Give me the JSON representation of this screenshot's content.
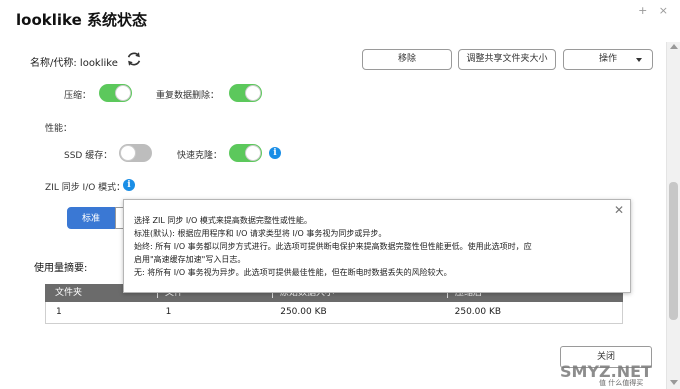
{
  "window": {
    "title": "looklike  系统状态",
    "controls": "+  ×"
  },
  "header": {
    "name_label": "名称/代称: looklike",
    "buttons": {
      "remove": "移除",
      "resize": "调整共享文件夹大小",
      "action": "操作"
    }
  },
  "options": {
    "compress": {
      "label": "压缩：",
      "state": "on"
    },
    "dedup": {
      "label": "重复数据删除：",
      "state": "on"
    },
    "performance_label": "性能：",
    "ssd_cache": {
      "label": "SSD 缓存：",
      "state": "off"
    },
    "fast_clone": {
      "label": "快速克隆：",
      "state": "on"
    },
    "zil_label": "ZIL 同步 I/O 模式："
  },
  "zil_modes": {
    "standard": "标准",
    "second": ""
  },
  "tooltip": {
    "lines": [
      "选择 ZIL 同步 I/O 模式来提高数据完整性或性能。",
      "标准(默认): 根据应用程序和 I/O 请求类型将 I/O 事务视为同步或异步。",
      "始终: 所有 I/O 事务都以同步方式进行。此选项可提供断电保护来提高数据完整性但性能更低。使用此选项时，应",
      "启用\"高速缓存加速\"写入日志。",
      "无: 将所有 I/O 事务视为异步。此选项可提供最佳性能，但在断电时数据丢失的风险较大。"
    ]
  },
  "usage": {
    "title": "使用量摘要:",
    "columns": [
      "文件夹",
      "文件",
      "原始数据大小",
      "压缩后"
    ],
    "rows": [
      [
        "1",
        "1",
        "250.00 KB",
        "250.00 KB"
      ]
    ]
  },
  "footer": {
    "close": "关闭"
  },
  "watermark": {
    "main": "SMYZ.NET",
    "sub": "值 什么值得买"
  },
  "colors": {
    "toggle_on": "#5cc85c",
    "toggle_off": "#bdbdbd",
    "accent": "#3a78d4",
    "info": "#1a8ee6"
  }
}
